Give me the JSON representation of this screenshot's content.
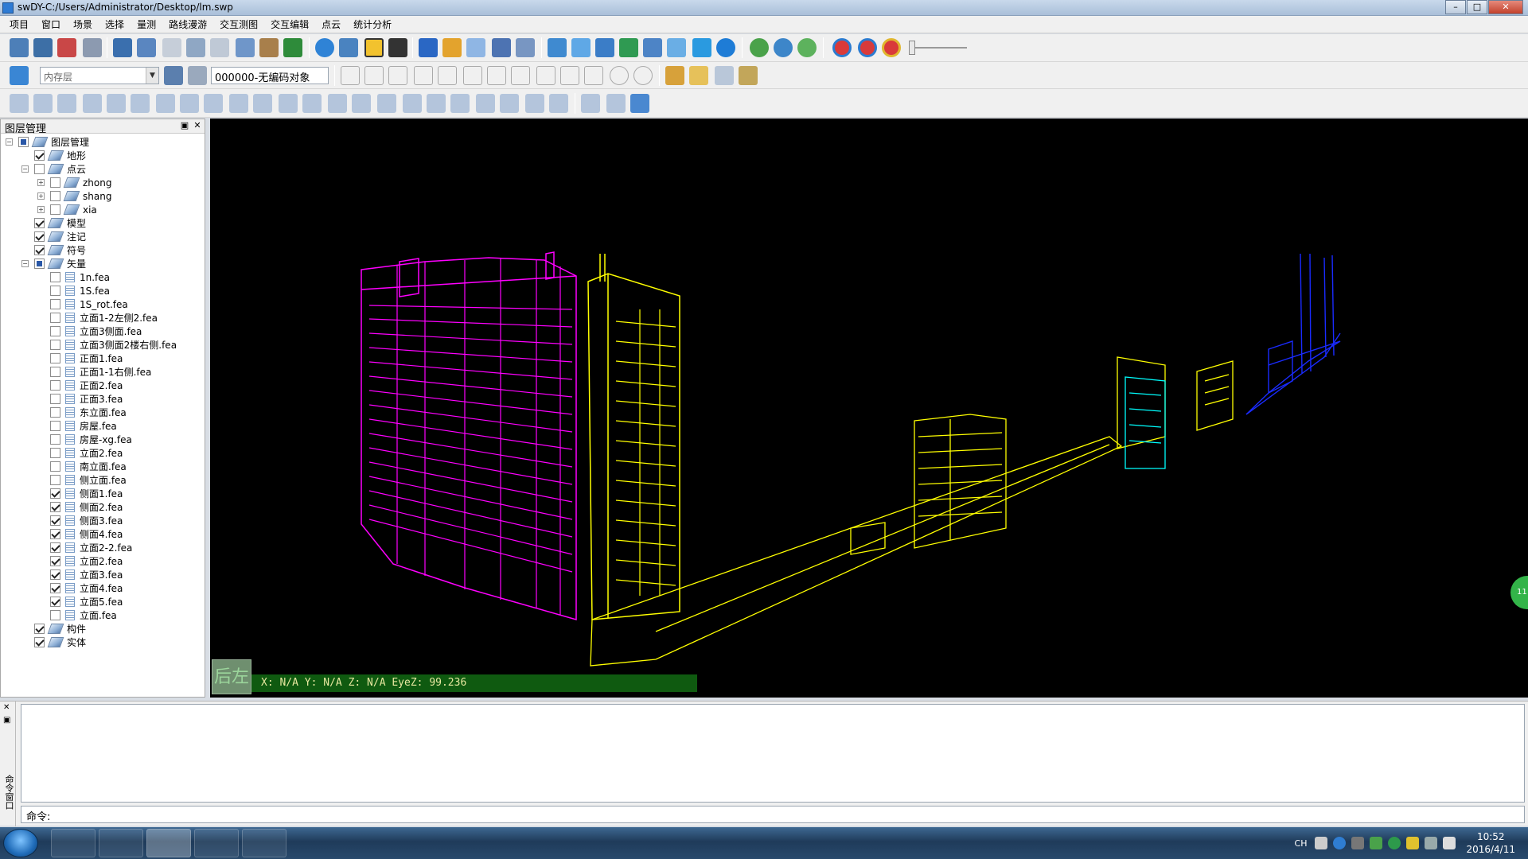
{
  "window": {
    "title": "swDY-C:/Users/Administrator/Desktop/lm.swp",
    "min_label": "–",
    "max_label": "□",
    "close_label": "✕"
  },
  "menu": [
    "项目",
    "窗口",
    "场景",
    "选择",
    "量测",
    "路线漫游",
    "交互测图",
    "交互编辑",
    "点云",
    "统计分析"
  ],
  "toolbar2": {
    "layer_combo": "内存层",
    "code_value": "000000-无编码对象"
  },
  "layer_panel": {
    "title": "图层管理",
    "pin_label": "▣",
    "close_label": "✕",
    "tree": [
      {
        "label": "图层管理",
        "level": 0,
        "expand": "minus",
        "check": "part",
        "icon": "layer"
      },
      {
        "label": "地形",
        "level": 1,
        "expand": "none",
        "check": "on",
        "icon": "layer"
      },
      {
        "label": "点云",
        "level": 1,
        "expand": "minus",
        "check": "off",
        "icon": "layer"
      },
      {
        "label": "zhong",
        "level": 2,
        "expand": "plus",
        "check": "off",
        "icon": "layer"
      },
      {
        "label": "shang",
        "level": 2,
        "expand": "plus",
        "check": "off",
        "icon": "layer"
      },
      {
        "label": "xia",
        "level": 2,
        "expand": "plus",
        "check": "off",
        "icon": "layer"
      },
      {
        "label": "模型",
        "level": 1,
        "expand": "none",
        "check": "on",
        "icon": "layer"
      },
      {
        "label": "注记",
        "level": 1,
        "expand": "none",
        "check": "on",
        "icon": "layer"
      },
      {
        "label": "符号",
        "level": 1,
        "expand": "none",
        "check": "on",
        "icon": "layer"
      },
      {
        "label": "矢量",
        "level": 1,
        "expand": "minus",
        "check": "part",
        "icon": "layer"
      },
      {
        "label": "1n.fea",
        "level": 2,
        "expand": "none",
        "check": "off",
        "icon": "fea"
      },
      {
        "label": "1S.fea",
        "level": 2,
        "expand": "none",
        "check": "off",
        "icon": "fea"
      },
      {
        "label": "1S_rot.fea",
        "level": 2,
        "expand": "none",
        "check": "off",
        "icon": "fea"
      },
      {
        "label": "立面1-2左侧2.fea",
        "level": 2,
        "expand": "none",
        "check": "off",
        "icon": "fea"
      },
      {
        "label": "立面3侧面.fea",
        "level": 2,
        "expand": "none",
        "check": "off",
        "icon": "fea"
      },
      {
        "label": "立面3侧面2楼右侧.fea",
        "level": 2,
        "expand": "none",
        "check": "off",
        "icon": "fea"
      },
      {
        "label": "正面1.fea",
        "level": 2,
        "expand": "none",
        "check": "off",
        "icon": "fea"
      },
      {
        "label": "正面1-1右侧.fea",
        "level": 2,
        "expand": "none",
        "check": "off",
        "icon": "fea"
      },
      {
        "label": "正面2.fea",
        "level": 2,
        "expand": "none",
        "check": "off",
        "icon": "fea"
      },
      {
        "label": "正面3.fea",
        "level": 2,
        "expand": "none",
        "check": "off",
        "icon": "fea"
      },
      {
        "label": "东立面.fea",
        "level": 2,
        "expand": "none",
        "check": "off",
        "icon": "fea"
      },
      {
        "label": "房屋.fea",
        "level": 2,
        "expand": "none",
        "check": "off",
        "icon": "fea"
      },
      {
        "label": "房屋-xg.fea",
        "level": 2,
        "expand": "none",
        "check": "off",
        "icon": "fea"
      },
      {
        "label": "立面2.fea",
        "level": 2,
        "expand": "none",
        "check": "off",
        "icon": "fea"
      },
      {
        "label": "南立面.fea",
        "level": 2,
        "expand": "none",
        "check": "off",
        "icon": "fea"
      },
      {
        "label": "侧立面.fea",
        "level": 2,
        "expand": "none",
        "check": "off",
        "icon": "fea"
      },
      {
        "label": "侧面1.fea",
        "level": 2,
        "expand": "none",
        "check": "on",
        "icon": "fea"
      },
      {
        "label": "侧面2.fea",
        "level": 2,
        "expand": "none",
        "check": "on",
        "icon": "fea"
      },
      {
        "label": "侧面3.fea",
        "level": 2,
        "expand": "none",
        "check": "on",
        "icon": "fea"
      },
      {
        "label": "侧面4.fea",
        "level": 2,
        "expand": "none",
        "check": "on",
        "icon": "fea"
      },
      {
        "label": "立面2-2.fea",
        "level": 2,
        "expand": "none",
        "check": "on",
        "icon": "fea"
      },
      {
        "label": "立面2.fea",
        "level": 2,
        "expand": "none",
        "check": "on",
        "icon": "fea"
      },
      {
        "label": "立面3.fea",
        "level": 2,
        "expand": "none",
        "check": "on",
        "icon": "fea"
      },
      {
        "label": "立面4.fea",
        "level": 2,
        "expand": "none",
        "check": "on",
        "icon": "fea"
      },
      {
        "label": "立面5.fea",
        "level": 2,
        "expand": "none",
        "check": "on",
        "icon": "fea"
      },
      {
        "label": "立面.fea",
        "level": 2,
        "expand": "none",
        "check": "off",
        "icon": "fea"
      },
      {
        "label": "构件",
        "level": 1,
        "expand": "none",
        "check": "on",
        "icon": "layer"
      },
      {
        "label": "实体",
        "level": 1,
        "expand": "none",
        "check": "on",
        "icon": "layer"
      }
    ]
  },
  "view3d": {
    "nav_cube_label": "后左",
    "coord_readout": "X: N/A Y: N/A Z: N/A EyeZ: 99.236",
    "float_badge": "11",
    "colors": {
      "magenta": "#ff00ff",
      "yellow": "#ffff00",
      "cyan": "#00ffff",
      "blue": "#0000ff",
      "background": "#000000"
    }
  },
  "command": {
    "side_label": "命令窗口",
    "prompt": "命令:"
  },
  "taskbar": {
    "lang": "CH",
    "time": "10:52",
    "date": "2016/4/11"
  }
}
